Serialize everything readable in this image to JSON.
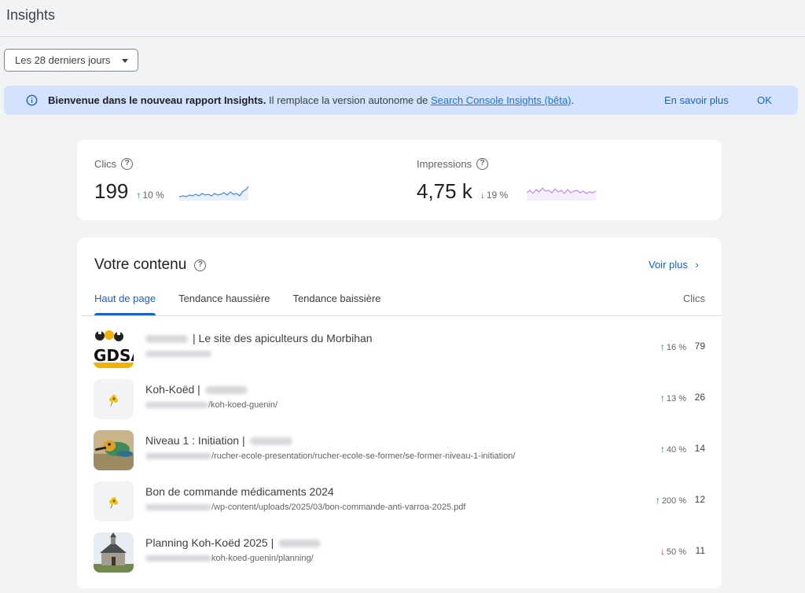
{
  "header": {
    "title": "Insights"
  },
  "range": {
    "selected": "Les 28 derniers jours"
  },
  "banner": {
    "bold": "Bienvenue dans le nouveau rapport Insights.",
    "text": " Il remplace la version autonome de ",
    "link": "Search Console Insights (bêta)",
    "after": ".",
    "learn_more": "En savoir plus",
    "ok": "OK"
  },
  "metrics": {
    "clicks": {
      "label": "Clics",
      "value": "199",
      "delta": "10 %",
      "direction": "up",
      "color": "#1a73e8"
    },
    "impressions": {
      "label": "Impressions",
      "value": "4,75 k",
      "delta": "19 %",
      "direction": "down",
      "color": "#9334e6"
    }
  },
  "content": {
    "title": "Votre contenu",
    "see_more": "Voir plus",
    "tabs": [
      "Haut de page",
      "Tendance haussière",
      "Tendance baissière"
    ],
    "active_tab": 0,
    "column": "Clics",
    "rows": [
      {
        "title": "| Le site des apiculteurs du Morbihan",
        "url_suffix": "",
        "change": "16 %",
        "direction": "up",
        "clicks": "79",
        "thumb": "logo"
      },
      {
        "title": "Koh-Koëd |",
        "url_suffix": "/koh-koed-guenin/",
        "change": "13 %",
        "direction": "up",
        "clicks": "26",
        "thumb": "placeholder"
      },
      {
        "title": "Niveau 1 : Initiation |",
        "url_suffix": "/rucher-ecole-presentation/rucher-ecole-se-former/se-former-niveau-1-initiation/",
        "change": "40 %",
        "direction": "up",
        "clicks": "14",
        "thumb": "bird"
      },
      {
        "title": "Bon de commande médicaments 2024",
        "url_suffix": "/wp-content/uploads/2025/03/bon-commande-anti-varroa-2025.pdf",
        "change": "200 %",
        "direction": "up",
        "clicks": "12",
        "thumb": "placeholder"
      },
      {
        "title": "Planning Koh-Koëd 2025 |",
        "url_suffix": "koh-koed-guenin/planning/",
        "change": "50 %",
        "direction": "down",
        "clicks": "11",
        "thumb": "chapel"
      }
    ]
  }
}
